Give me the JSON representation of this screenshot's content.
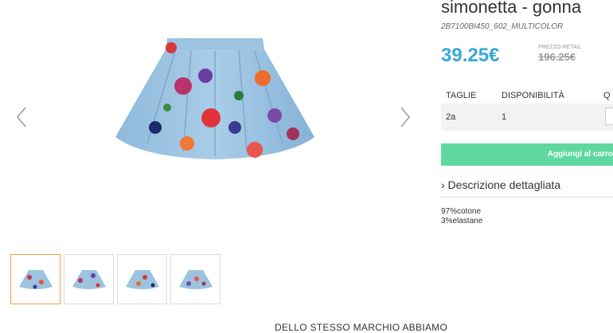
{
  "gallery": {
    "prev_icon": "chevron-left-icon",
    "next_icon": "chevron-right-icon",
    "thumbnails": [
      {
        "active": true
      },
      {
        "active": false
      },
      {
        "active": false
      },
      {
        "active": false
      }
    ]
  },
  "product": {
    "title": "simonetta - gonna",
    "sku": "2B7100BI450_602_MULTICOLOR",
    "price": "39.25€",
    "retail_label": "PREZZO RETAIL",
    "retail_price": "196.25€"
  },
  "sizes_table": {
    "headers": [
      "TAGLIE",
      "DISPONIBILITÀ",
      "Q"
    ],
    "row": {
      "size": "2a",
      "availability": "1"
    }
  },
  "cart": {
    "button_label": "Aggiungi al carro"
  },
  "description": {
    "toggle_label": "› Descrizione dettagliata",
    "composition": [
      "97%cotone",
      "3%elastane"
    ]
  },
  "brand_section": {
    "heading": "DELLO STESSO MARCHIO ABBIAMO"
  },
  "colors": {
    "price": "#3aa8d8",
    "cart_button": "#5fd8a0",
    "thumb_active_border": "#f0a04b"
  }
}
